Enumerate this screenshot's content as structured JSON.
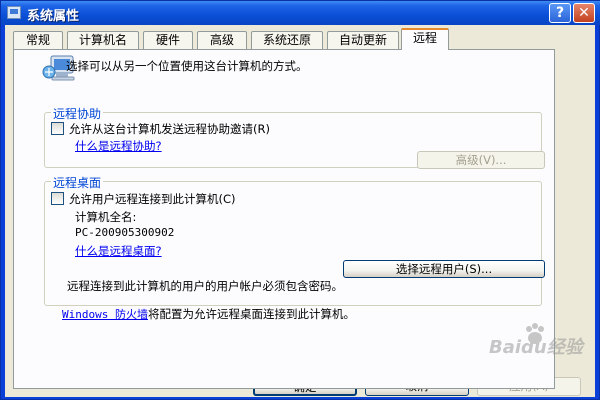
{
  "window": {
    "title": "系统属性",
    "help_glyph": "?",
    "close_glyph": "✕"
  },
  "tabs": [
    "常规",
    "计算机名",
    "硬件",
    "高级",
    "系统还原",
    "自动更新",
    "远程"
  ],
  "intro": "选择可以从另一个位置使用这台计算机的方式。",
  "remote_assistance": {
    "legend": "远程协助",
    "checkbox": "允许从这台计算机发送远程协助邀请(R)",
    "help_link": "什么是远程协助?",
    "advanced_button": "高级(V)..."
  },
  "remote_desktop": {
    "legend": "远程桌面",
    "checkbox": "允许用户远程连接到此计算机(C)",
    "full_name_label": "计算机全名:",
    "computer_name": "PC-200905300902",
    "help_link": "什么是远程桌面?",
    "select_users_button": "选择远程用户(S)...",
    "note": "远程连接到此计算机的用户的用户帐户必须包含密码。"
  },
  "firewall": {
    "link": "Windows 防火墙",
    "text": "将配置为允许远程桌面连接到此计算机。"
  },
  "buttons": {
    "ok": "确定",
    "cancel": "取消",
    "apply": "应用(A)"
  },
  "watermark": {
    "text": "Baidu经验"
  },
  "colors": {
    "title_bar": "#0a4fd6",
    "group_legend": "#0046d5",
    "active_tab_accent": "#e68b2c",
    "link": "#0000ee"
  }
}
